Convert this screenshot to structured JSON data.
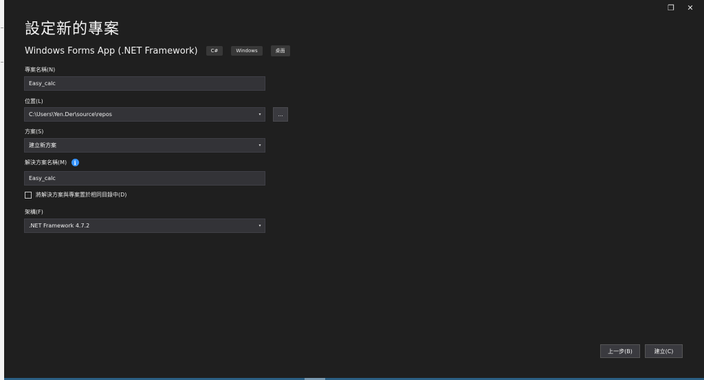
{
  "window": {
    "restore_glyph": "❐",
    "close_glyph": "✕"
  },
  "dialog": {
    "title": "設定新的專案",
    "template": {
      "name": "Windows Forms App (.NET Framework)",
      "tags": [
        "C#",
        "Windows",
        "桌面"
      ]
    },
    "fields": {
      "project_name": {
        "label": "專案名稱(N)",
        "value": "Easy_calc"
      },
      "location": {
        "label": "位置(L)",
        "value": "C:\\Users\\Yen.Der\\source\\repos",
        "browse_label": "..."
      },
      "solution": {
        "label": "方案(S)",
        "value": "建立新方案"
      },
      "solution_name": {
        "label": "解決方案名稱(M)",
        "value": "Easy_calc",
        "info_glyph": "i"
      },
      "same_dir": {
        "label": "將解決方案與專案置於相同目錄中(D)",
        "checked": false
      },
      "framework": {
        "label": "架構(F)",
        "value": ".NET Framework 4.7.2"
      }
    },
    "buttons": {
      "back": "上一步(B)",
      "create": "建立(C)"
    },
    "dropdown_glyph": "▾"
  }
}
